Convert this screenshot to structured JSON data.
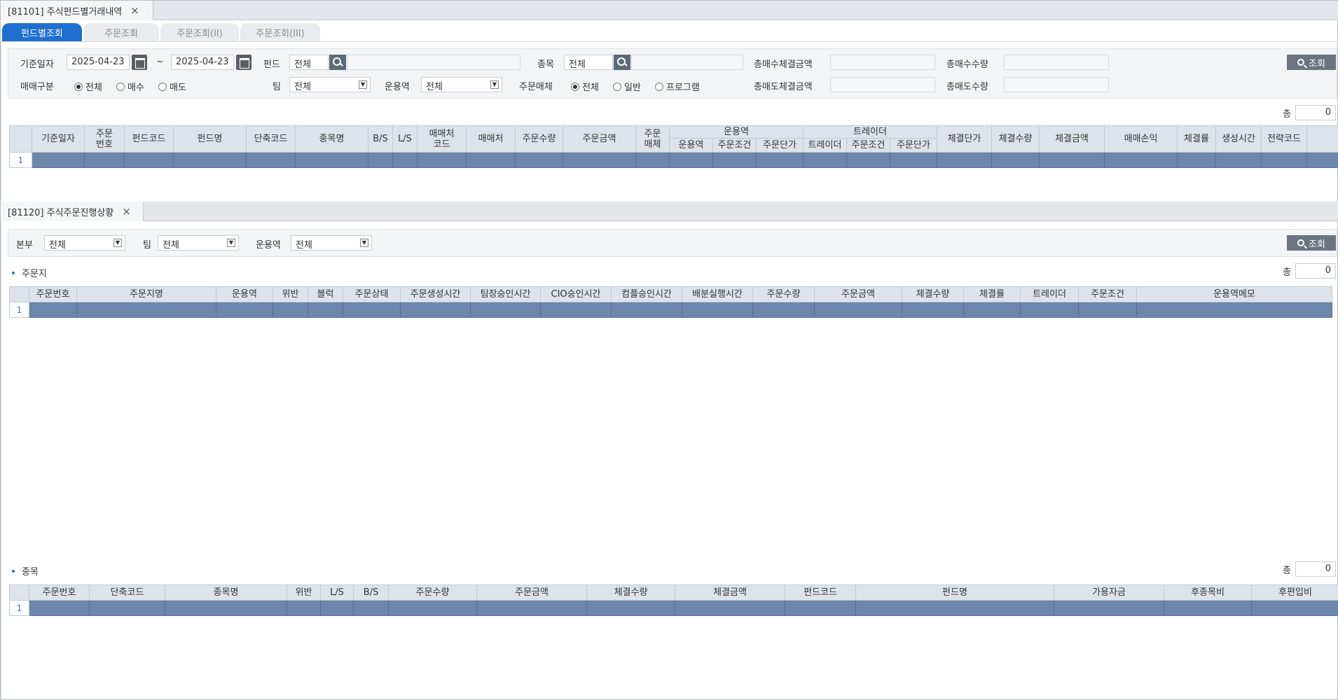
{
  "window1": {
    "tab_title": "[81101] 주식펀드별거래내역",
    "close": "×",
    "tabs": [
      "펀드별조회",
      "주문조회",
      "주문조회(II)",
      "주문조회(III)"
    ],
    "filters": {
      "base_date_label": "기준일자",
      "date_from": "2025-04-23",
      "tilde": "~",
      "date_to": "2025-04-23",
      "fund_label": "펀드",
      "fund_value": "전체",
      "stock_label": "종목",
      "stock_value": "전체",
      "total_buy_amt_label": "총매수체결금액",
      "total_buy_qty_label": "총매수수량",
      "trade_type_label": "매매구분",
      "trade_type_options": [
        "전체",
        "매수",
        "매도"
      ],
      "team_label": "팀",
      "team_value": "전체",
      "manager_label": "운용역",
      "manager_value": "전체",
      "medium_label": "주문매체",
      "medium_options": [
        "전체",
        "일반",
        "프로그램"
      ],
      "total_sell_amt_label": "총매도체결금액",
      "total_sell_qty_label": "총매도수량",
      "query_label": "조회"
    },
    "count_label": "총",
    "count_value": "0",
    "grid_headers": {
      "c1": "기준일자",
      "c2a": "주문",
      "c2b": "번호",
      "c3": "펀드코드",
      "c4": "펀드명",
      "c5": "단축코드",
      "c6": "종목명",
      "c7": "B/S",
      "c8": "L/S",
      "c9a": "매매처",
      "c9b": "코드",
      "c10": "매매처",
      "c11": "주문수량",
      "c12": "주문금액",
      "c13a": "주문",
      "c13b": "매체",
      "g1": "운용역",
      "g1a": "운용역",
      "g1b": "주문조건",
      "g1c": "주문단가",
      "g2": "트레이더",
      "g2a": "트레이더",
      "g2b": "주문조건",
      "g2c": "주문단가",
      "c14": "체결단가",
      "c15": "체결수량",
      "c16": "체결금액",
      "c17": "매매손익",
      "c18": "체결률",
      "c19": "생성시간",
      "c20": "전략코드"
    },
    "row_number": "1"
  },
  "window2": {
    "tab_title": "[81120] 주식주문진행상황",
    "close": "×",
    "filters": {
      "hq_label": "본부",
      "hq_value": "전체",
      "team_label": "팀",
      "team_value": "전체",
      "manager_label": "운용역",
      "manager_value": "전체",
      "query_label": "조회"
    },
    "section1_title": "주문지",
    "section2_title": "종목",
    "count_label": "총",
    "count_value": "0",
    "grid1_headers": [
      "주문번호",
      "주문지명",
      "운용역",
      "위반",
      "블럭",
      "주문상태",
      "주문생성시간",
      "팀장승인시간",
      "CIO승인시간",
      "컴플승인시간",
      "배분실행시간",
      "주문수량",
      "주문금액",
      "체결수량",
      "체결률",
      "트레이더",
      "주문조건",
      "운용역메모"
    ],
    "grid2_headers": [
      "주문번호",
      "단축코드",
      "종목명",
      "위반",
      "L/S",
      "B/S",
      "주문수량",
      "주문금액",
      "체결수량",
      "체결금액",
      "펀드코드",
      "펀드명",
      "가용자금",
      "후종목비",
      "후편입비"
    ],
    "row_number": "1"
  }
}
